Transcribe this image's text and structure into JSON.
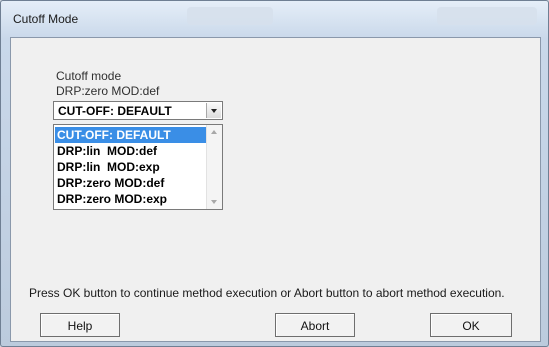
{
  "window": {
    "title": "Cutoff Mode"
  },
  "form": {
    "section_label": "Cutoff mode",
    "current_value": "DRP:zero MOD:def",
    "combo": {
      "selected": "CUT-OFF: DEFAULT"
    },
    "options": [
      "CUT-OFF: DEFAULT",
      "DRP:lin  MOD:def",
      "DRP:lin  MOD:exp",
      "DRP:zero MOD:def",
      "DRP:zero MOD:exp"
    ],
    "highlighted_option": "CUT-OFF: DEFAULT"
  },
  "status_text": "Press OK button to continue method execution or Abort button to abort method execution.",
  "buttons": {
    "help": "Help",
    "abort": "Abort",
    "ok": "OK"
  },
  "colors": {
    "selection": "#3a8ee6",
    "client_bg": "#f0f0f0"
  }
}
